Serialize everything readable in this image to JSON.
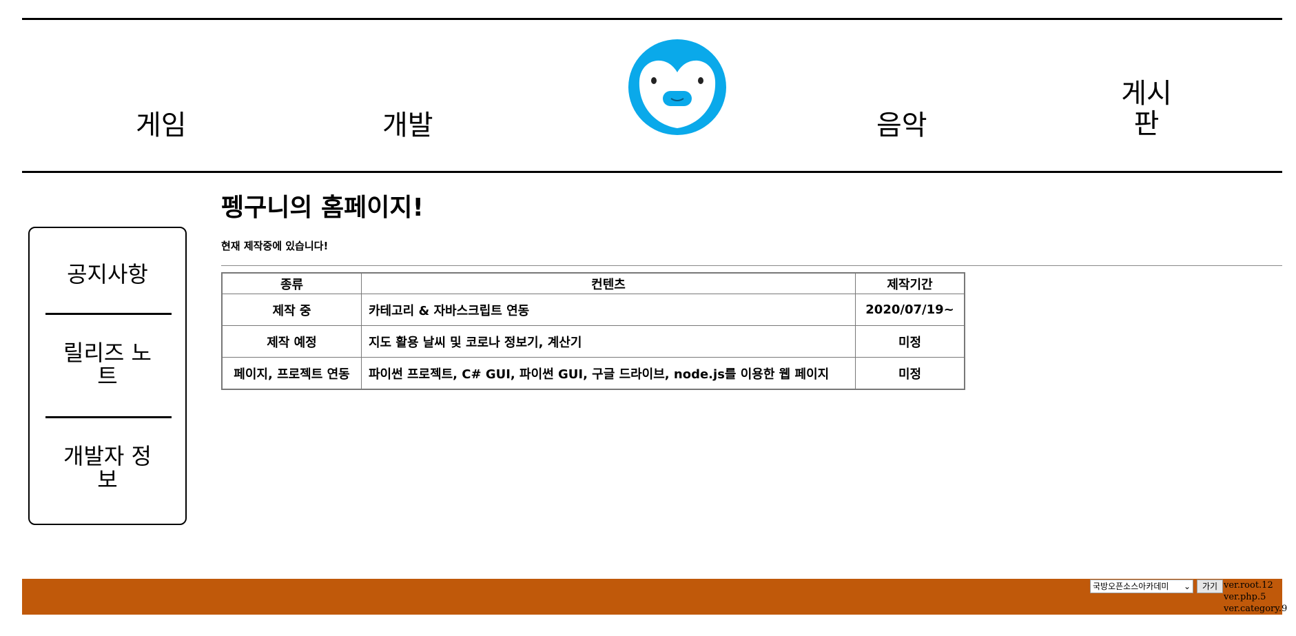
{
  "nav": {
    "game": "게임",
    "dev": "개발",
    "music": "음악",
    "board": "게시판"
  },
  "sidebar": {
    "items": [
      "공지사항",
      "릴리즈 노트",
      "개발자 정보"
    ]
  },
  "main": {
    "title": "펭구니의 홈페이지!",
    "subtitle": "현재 제작중에 있습니다!"
  },
  "table": {
    "headers": [
      "종류",
      "컨텐츠",
      "제작기간"
    ],
    "rows": [
      [
        "제작 중",
        "카테고리 & 자바스크립트 연동",
        "2020/07/19~"
      ],
      [
        "제작 예정",
        "지도 활용 날씨 및 코로나 정보기, 계산기",
        "미정"
      ],
      [
        "페이지, 프로젝트 연동",
        "파이썬 프로젝트, C# GUI, 파이썬 GUI, 구글 드라이브, node.js를 이용한 웹 페이지",
        "미정"
      ]
    ]
  },
  "footer": {
    "select_value": "국방오픈소스아카데미",
    "go_label": "가기",
    "versions": [
      "ver.root.12",
      "ver.php.5",
      "ver.category.9"
    ]
  },
  "colors": {
    "footer": "#c0590a",
    "penguin": "#0aa9ea"
  },
  "icons": {
    "logo": "penguin-logo-icon",
    "select": "chevron-down-icon"
  }
}
